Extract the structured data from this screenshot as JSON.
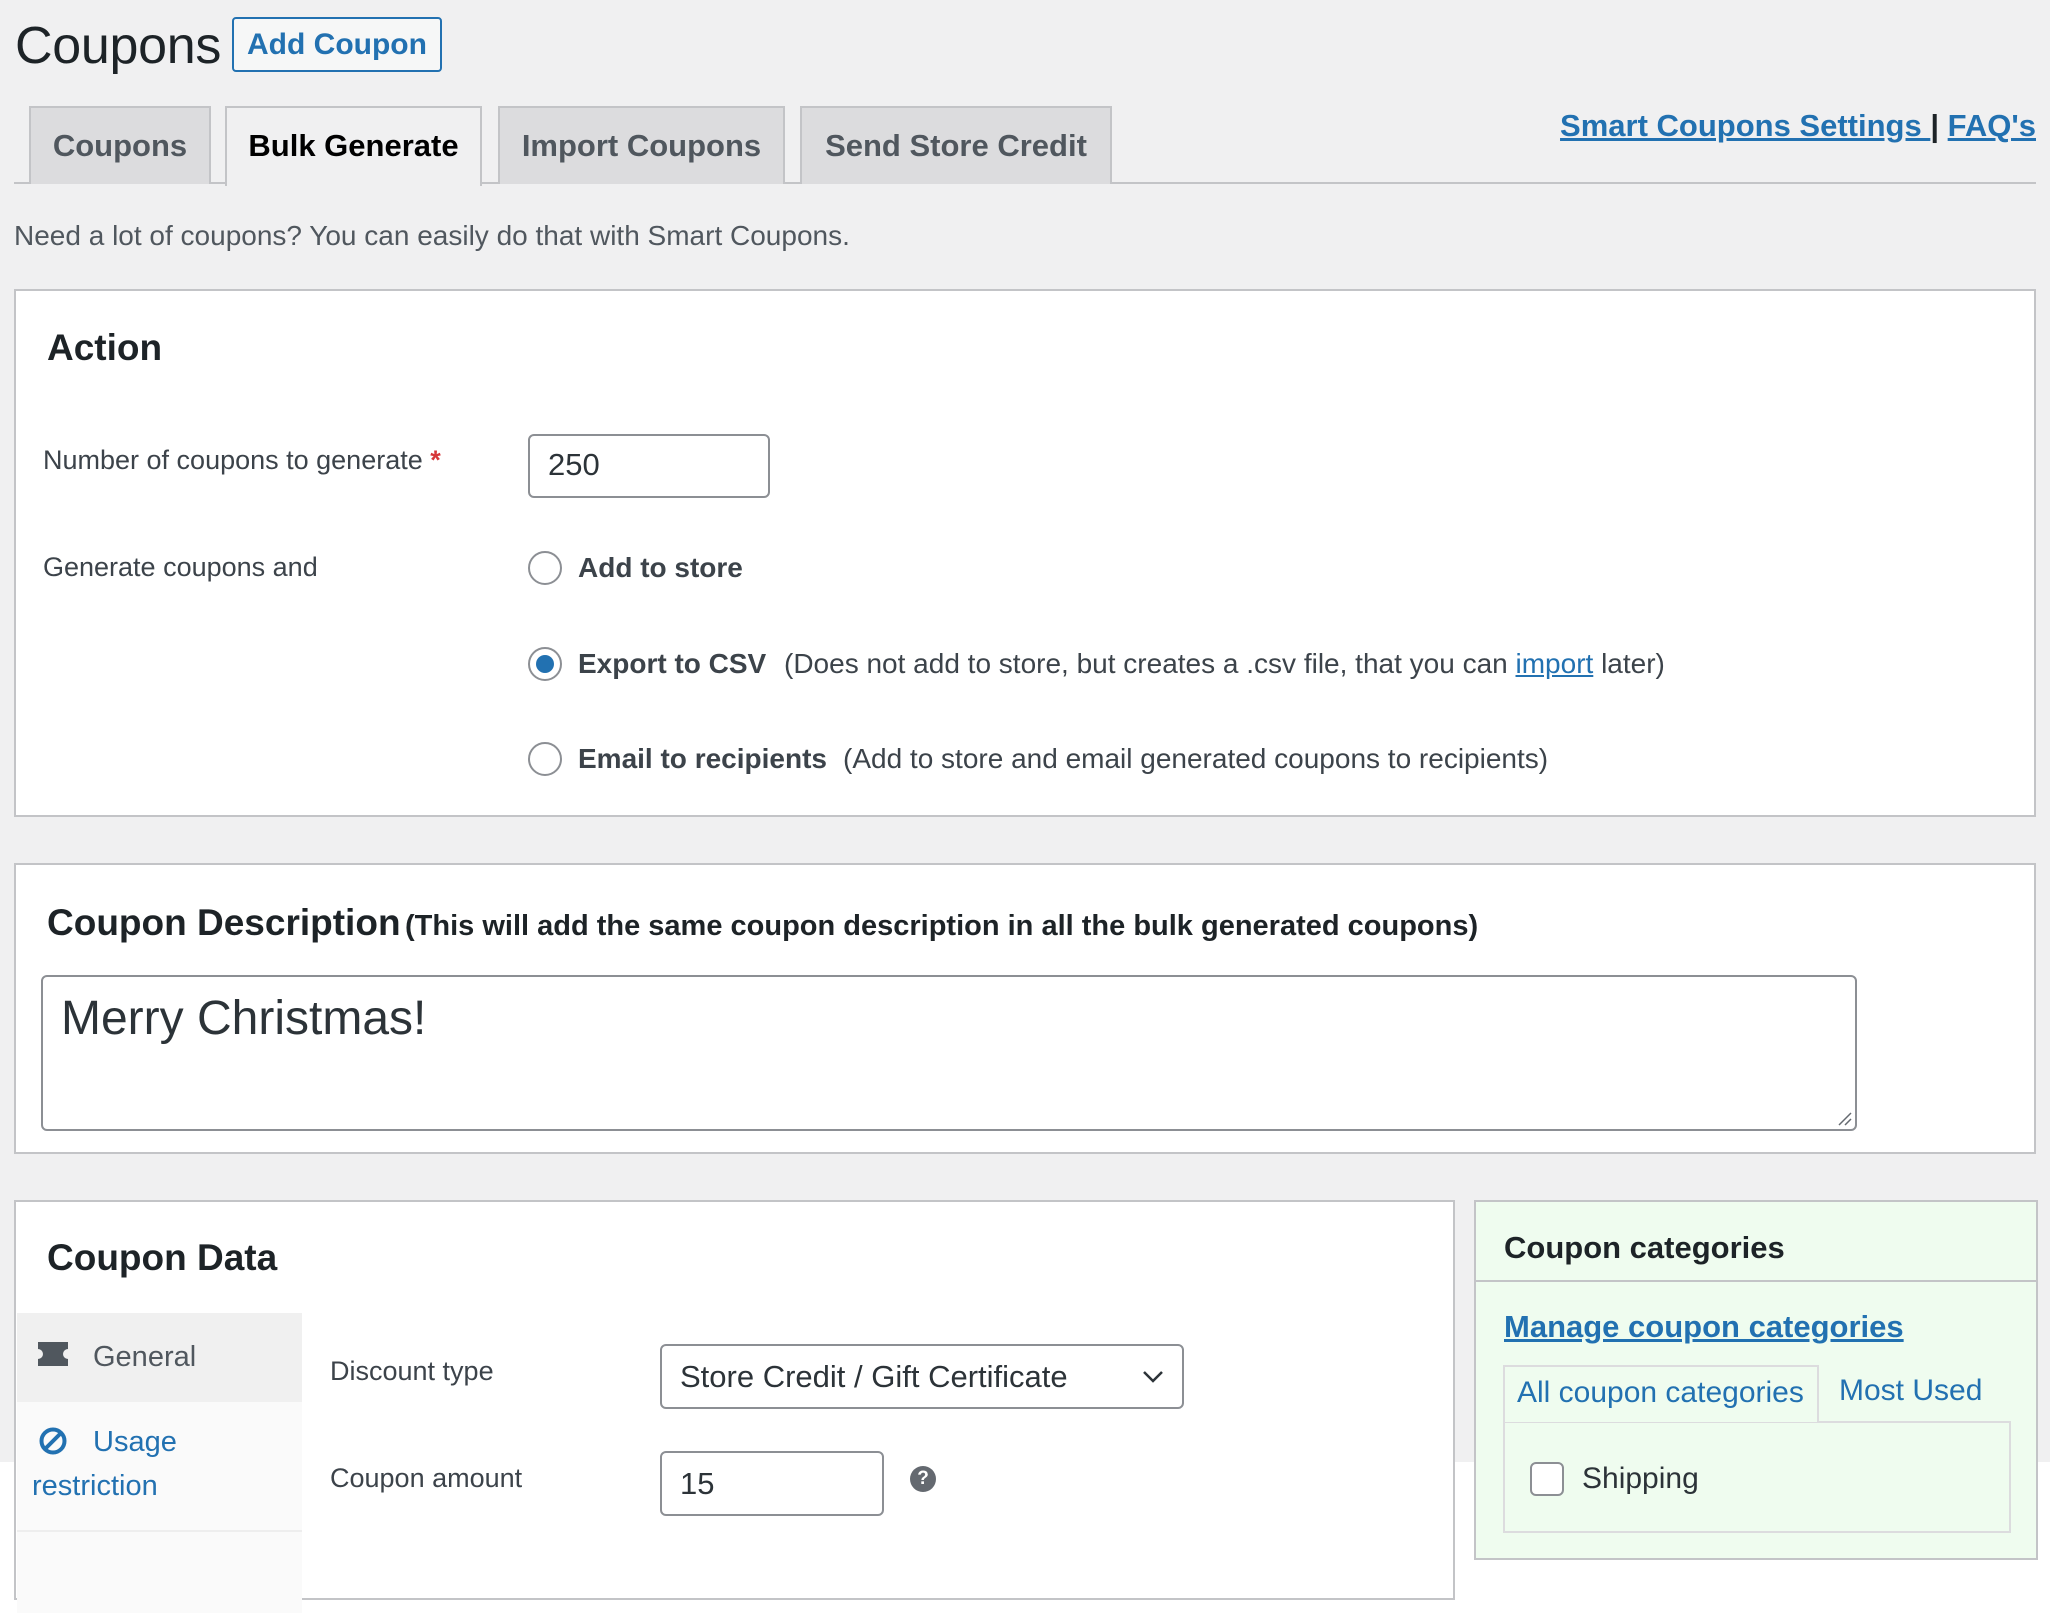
{
  "header": {
    "title": "Coupons",
    "add_button": "Add Coupon"
  },
  "tabs": [
    {
      "label": "Coupons",
      "active": false
    },
    {
      "label": "Bulk Generate",
      "active": true
    },
    {
      "label": "Import Coupons",
      "active": false
    },
    {
      "label": "Send Store Credit",
      "active": false
    }
  ],
  "top_links": {
    "settings": "Smart Coupons Settings ",
    "separator": "|",
    "faq": "FAQ's"
  },
  "intro": "Need a lot of coupons? You can easily do that with Smart Coupons.",
  "action": {
    "heading": "Action",
    "number_label": "Number of coupons to generate",
    "required_mark": "*",
    "number_value": "250",
    "generate_label": "Generate coupons and",
    "options": [
      {
        "label": "Add to store",
        "note": "",
        "checked": false
      },
      {
        "label": "Export to CSV",
        "note_before": "(Does not add to store, but creates a .csv file, that you can ",
        "note_link": "import",
        "note_after": " later)",
        "checked": true
      },
      {
        "label": "Email to recipients",
        "note": "(Add to store and email generated coupons to recipients)",
        "checked": false
      }
    ]
  },
  "description": {
    "heading": "Coupon Description",
    "subheading": "(This will add the same coupon description in all the bulk generated coupons)",
    "value": "Merry Christmas!"
  },
  "coupon_data": {
    "heading": "Coupon Data",
    "sidebar": [
      {
        "label": "General",
        "icon": "ticket-icon",
        "active": true
      },
      {
        "label": "Usage restriction",
        "icon": "no-entry-icon",
        "active": false
      }
    ],
    "discount_type_label": "Discount type",
    "discount_type_value": "Store Credit / Gift Certificate",
    "amount_label": "Coupon amount",
    "amount_value": "15",
    "help_icon": "?"
  },
  "categories": {
    "title": "Coupon categories",
    "manage_link": "Manage coupon categories",
    "tabs": [
      "All coupon categories",
      "Most Used"
    ],
    "items": [
      {
        "label": "Shipping",
        "checked": false
      }
    ]
  },
  "colors": {
    "accent": "#2271b1",
    "page_bg": "#f0f0f1",
    "categories_bg": "#effcef",
    "required": "#d63638"
  }
}
